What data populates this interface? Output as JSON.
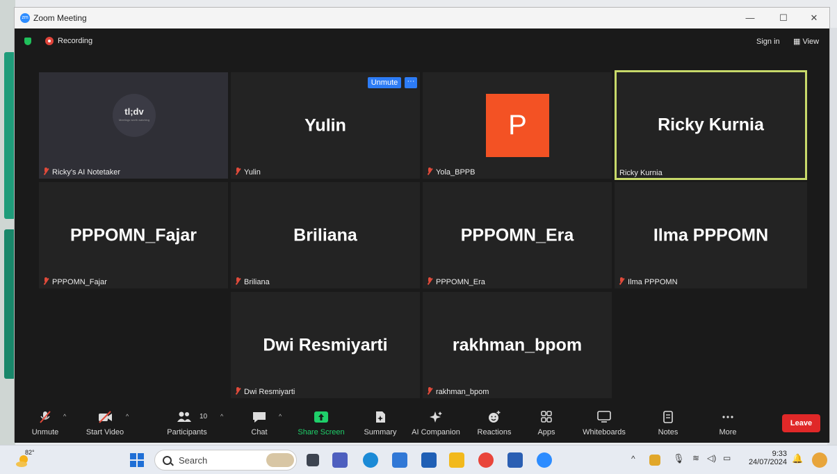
{
  "window": {
    "title": "Zoom Meeting",
    "min": "—",
    "max": "☐",
    "close": "✕"
  },
  "topbar": {
    "recording": "Recording",
    "sign_in": "Sign in",
    "view": "View"
  },
  "tiles": [
    {
      "display": "",
      "name": "Ricky's AI Notetaker",
      "logo": "tl;dv",
      "logo_sub": "Meetings worth watching"
    },
    {
      "display": "Yulin",
      "name": "Yulin",
      "unmute": "Unmute",
      "more": "···"
    },
    {
      "display": "P",
      "name": "Yola_BPPB",
      "avatar_color": "#f35224"
    },
    {
      "display": "Ricky Kurnia",
      "name": "Ricky Kurnia",
      "active_color": "#c7d96a"
    },
    {
      "display": "PPPOMN_Fajar",
      "name": "PPPOMN_Fajar"
    },
    {
      "display": "Briliana",
      "name": "Briliana"
    },
    {
      "display": "PPPOMN_Era",
      "name": "PPPOMN_Era"
    },
    {
      "display": "Ilma PPPOMN",
      "name": "Ilma PPPOMN"
    },
    {
      "display": "Dwi Resmiyarti",
      "name": "Dwi Resmiyarti"
    },
    {
      "display": "rakhman_bpom",
      "name": "rakhman_bpom"
    }
  ],
  "toolbar": {
    "unmute": "Unmute",
    "start_video": "Start Video",
    "participants": "Participants",
    "participants_count": "10",
    "chat": "Chat",
    "share_screen": "Share Screen",
    "summary": "Summary",
    "ai_companion": "AI Companion",
    "reactions": "Reactions",
    "apps": "Apps",
    "whiteboards": "Whiteboards",
    "notes": "Notes",
    "more": "More",
    "leave": "Leave"
  },
  "taskbar": {
    "temperature": "82°",
    "search_placeholder": "Search",
    "time": "9:33",
    "date": "24/07/2024"
  },
  "colors": {
    "share_green": "#1fcf6a",
    "leave_red": "#e02828",
    "unmute_blue": "#2d7cf6"
  }
}
